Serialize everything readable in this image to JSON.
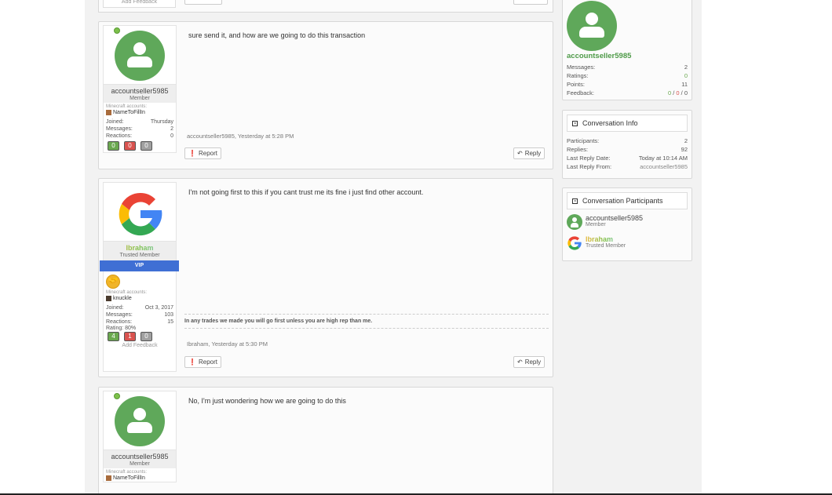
{
  "top_fragment": {
    "add_feedback": "Add Feedback"
  },
  "posts": [
    {
      "user": {
        "name": "accountseller5985",
        "title": "Member",
        "mc_label": "Minecraft accounts:",
        "mc_name": "NameToFillIn",
        "joined_label": "Joined:",
        "joined": "Thursday",
        "messages_label": "Messages:",
        "messages": "2",
        "reactions_label": "Reactions:",
        "reactions": "0",
        "badges": [
          "0",
          "0",
          "0"
        ]
      },
      "message": "sure send it, and how are we going to do this transaction",
      "meta": "accountseller5985, Yesterday at 5:28 PM",
      "report": "Report",
      "reply": "Reply"
    },
    {
      "user": {
        "name": "Ibraham",
        "title": "Trusted Member",
        "vip": "VIP",
        "mc_label": "Minecraft accounts:",
        "mc_name": "knuckle",
        "joined_label": "Joined:",
        "joined": "Oct 3, 2017",
        "messages_label": "Messages:",
        "messages": "103",
        "reactions_label": "Reactions:",
        "reactions": "15",
        "rating": "Rating: 80%",
        "badges": [
          "4",
          "1",
          "0"
        ],
        "add_feedback": "Add Feedback"
      },
      "message": "I'm not going first to this if you cant trust me its fine i just find other account.",
      "signature": "In any trades we made you will go first unless you are high rep than me.",
      "meta": "Ibraham, Yesterday at 5:30 PM",
      "report": "Report",
      "reply": "Reply"
    },
    {
      "user": {
        "name": "accountseller5985",
        "title": "Member",
        "mc_label": "Minecraft accounts:",
        "mc_name": "NameToFillIn"
      },
      "message": "No, I'm just wondering how we are going to do this"
    }
  ],
  "sidebar": {
    "profile": {
      "name": "accountseller5985",
      "stats": [
        {
          "label": "Messages:",
          "value": "2"
        },
        {
          "label": "Ratings:",
          "value": "0"
        },
        {
          "label": "Points:",
          "value": "11"
        }
      ],
      "feedback_label": "Feedback:",
      "feedback_pos": "0",
      "feedback_neu": "0",
      "feedback_neg": "0"
    },
    "conversation_info": {
      "title": "Conversation Info",
      "rows": [
        {
          "label": "Participants:",
          "value": "2"
        },
        {
          "label": "Replies:",
          "value": "92"
        },
        {
          "label": "Last Reply Date:",
          "value": "Today at 10:14 AM"
        },
        {
          "label": "Last Reply From:",
          "value": "accountseller5985"
        }
      ]
    },
    "participants": {
      "title": "Conversation Participants",
      "list": [
        {
          "name": "accountseller5985",
          "role": "Member"
        },
        {
          "name": "Ibraham",
          "role": "Trusted Member"
        }
      ]
    }
  },
  "colors": {
    "accent_green": "#5fa85a",
    "vip_blue": "#3f6fd4"
  }
}
